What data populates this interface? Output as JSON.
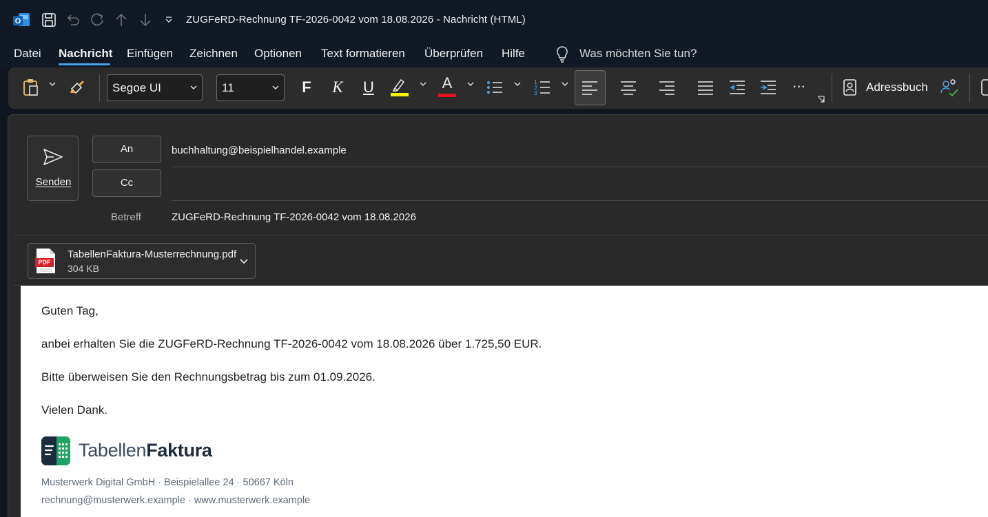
{
  "window": {
    "title": "ZUGFeRD-Rechnung TF-2026-0042 vom 18.08.2026  -  Nachricht (HTML)"
  },
  "menu": {
    "tabs": [
      "Datei",
      "Nachricht",
      "Einfügen",
      "Zeichnen",
      "Optionen",
      "Text formatieren",
      "Überprüfen",
      "Hilfe"
    ],
    "active": "Nachricht",
    "tell_me": "Was möchten Sie tun?"
  },
  "ribbon": {
    "font_name": "Segoe UI",
    "font_size": "11",
    "bold_glyph": "F",
    "italic_glyph": "K",
    "underline_glyph": "U",
    "font_color_glyph": "A",
    "more_glyph": "···",
    "address_book": "Adressbuch",
    "highlight_color": "#f5f500",
    "font_color": "#e81123"
  },
  "compose": {
    "send_label": "Senden",
    "to_label": "An",
    "cc_label": "Cc",
    "to_value": "buchhaltung@beispielhandel.example",
    "cc_value": "",
    "subject_label": "Betreff",
    "subject_value": "ZUGFeRD-Rechnung TF-2026-0042 vom 18.08.2026"
  },
  "attachment": {
    "name": "TabellenFaktura-Musterrechnung.pdf",
    "size": "304 KB",
    "icon_label": "PDF"
  },
  "body": {
    "greeting": "Guten Tag,",
    "line1": "anbei erhalten Sie die ZUGFeRD-Rechnung TF-2026-0042 vom 18.08.2026 über 1.725,50 EUR.",
    "line2": "Bitte überweisen Sie den Rechnungsbetrag bis zum 01.09.2026.",
    "closing": "Vielen Dank."
  },
  "signature": {
    "brand_light": "Tabellen",
    "brand_bold": "Faktura",
    "address": "Musterwerk Digital GmbH · Beispielallee 24 · 50667 Köln",
    "contact": "rechnung@musterwerk.example · www.musterwerk.example"
  }
}
